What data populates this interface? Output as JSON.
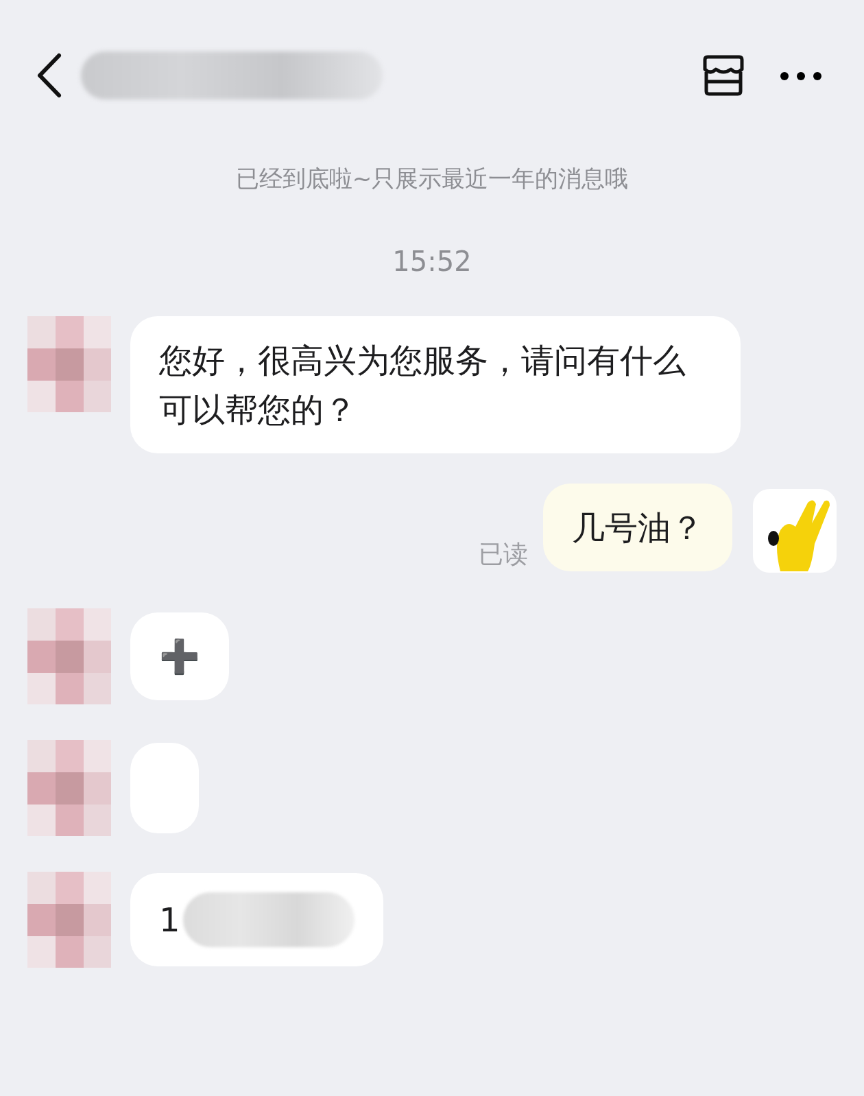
{
  "header": {
    "title_redacted": true
  },
  "notice": "已经到底啦~只展示最近一年的消息哦",
  "time": "15:52",
  "messages": [
    {
      "outgoing": false,
      "kind": "text",
      "text": "您好，很高兴为您服务，请问有什么可以帮您的？"
    },
    {
      "outgoing": true,
      "kind": "text",
      "text": "几号油？",
      "read_receipt": "已读"
    },
    {
      "outgoing": false,
      "kind": "emoji",
      "text": "➕"
    },
    {
      "outgoing": false,
      "kind": "redacted"
    },
    {
      "outgoing": false,
      "kind": "text_redacted",
      "text": "1"
    }
  ]
}
